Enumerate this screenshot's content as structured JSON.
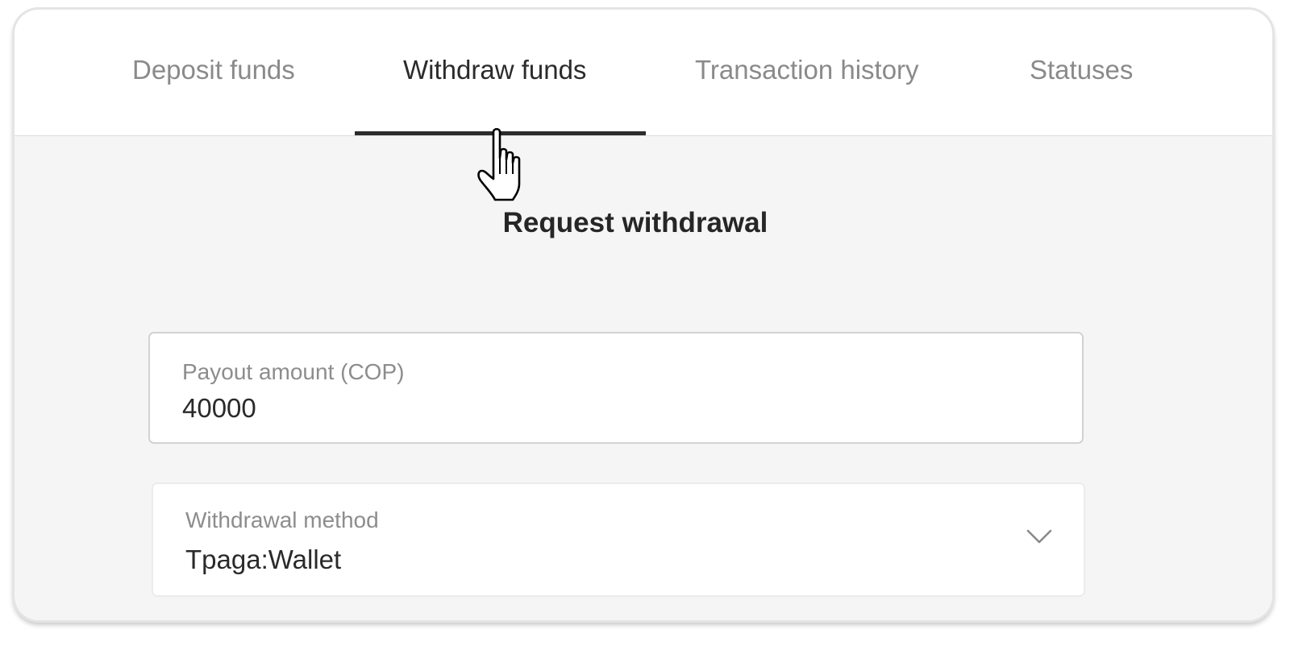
{
  "tabs": [
    {
      "label": "Deposit funds",
      "active": false
    },
    {
      "label": "Withdraw funds",
      "active": true
    },
    {
      "label": "Transaction history",
      "active": false
    },
    {
      "label": "Statuses",
      "active": false
    }
  ],
  "form": {
    "heading": "Request withdrawal",
    "payout_amount": {
      "label": "Payout amount (COP)",
      "value": "40000"
    },
    "withdrawal_method": {
      "label": "Withdrawal method",
      "value": "Tpaga:Wallet",
      "icon": "chevron-down-icon"
    }
  },
  "colors": {
    "active_tab_text": "#2b2b2b",
    "inactive_tab_text": "#8a8a8a",
    "active_underline": "#2c2c2c",
    "panel_background": "#f5f5f5"
  },
  "cursor": {
    "icon": "hand-pointer-icon"
  }
}
